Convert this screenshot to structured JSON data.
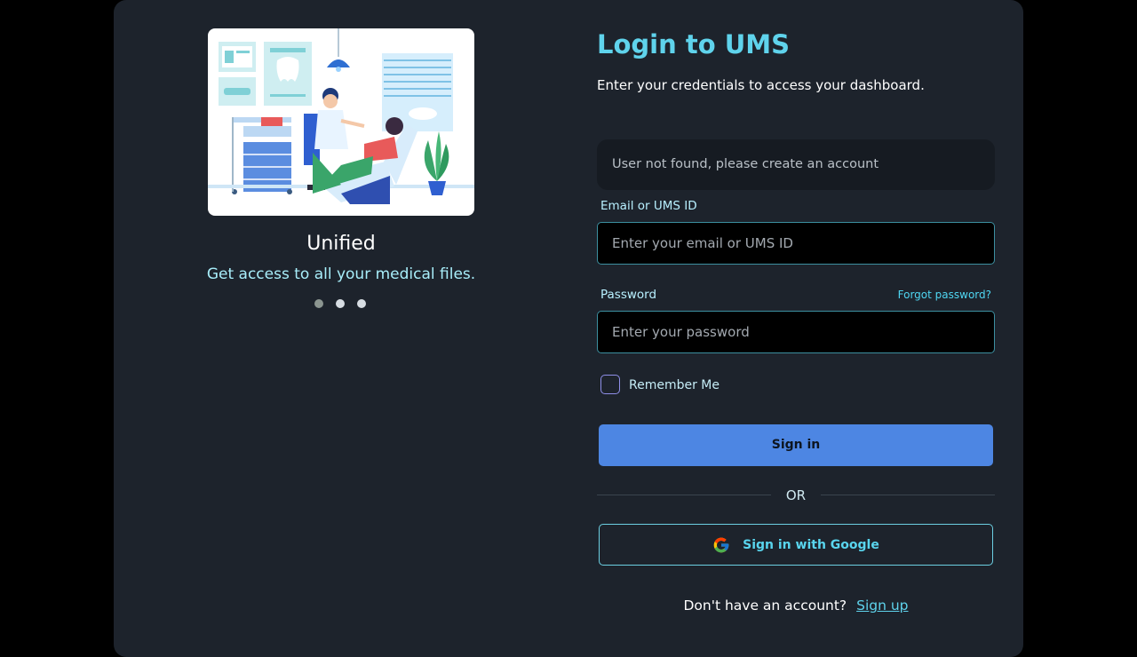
{
  "slider": {
    "title": "Unified",
    "subtitle": "Get access to all your medical files.",
    "active_index": 0,
    "dot_count": 3
  },
  "login": {
    "title": "Login to UMS",
    "subtitle": "Enter your credentials to access your dashboard.",
    "alert": "User not found, please create an account",
    "email_label": "Email or UMS ID",
    "email_placeholder": "Enter your email or UMS ID",
    "password_label": "Password",
    "forgot_label": "Forgot password?",
    "password_placeholder": "Enter your password",
    "remember_label": "Remember Me",
    "signin_label": "Sign in",
    "or_label": "OR",
    "google_label": "Sign in with Google",
    "footer_text": "Don't have an account?",
    "signup_label": "Sign up"
  },
  "colors": {
    "accent": "#5fd3ec",
    "primary_button": "#4d86e3",
    "card_bg": "#1d232c"
  }
}
